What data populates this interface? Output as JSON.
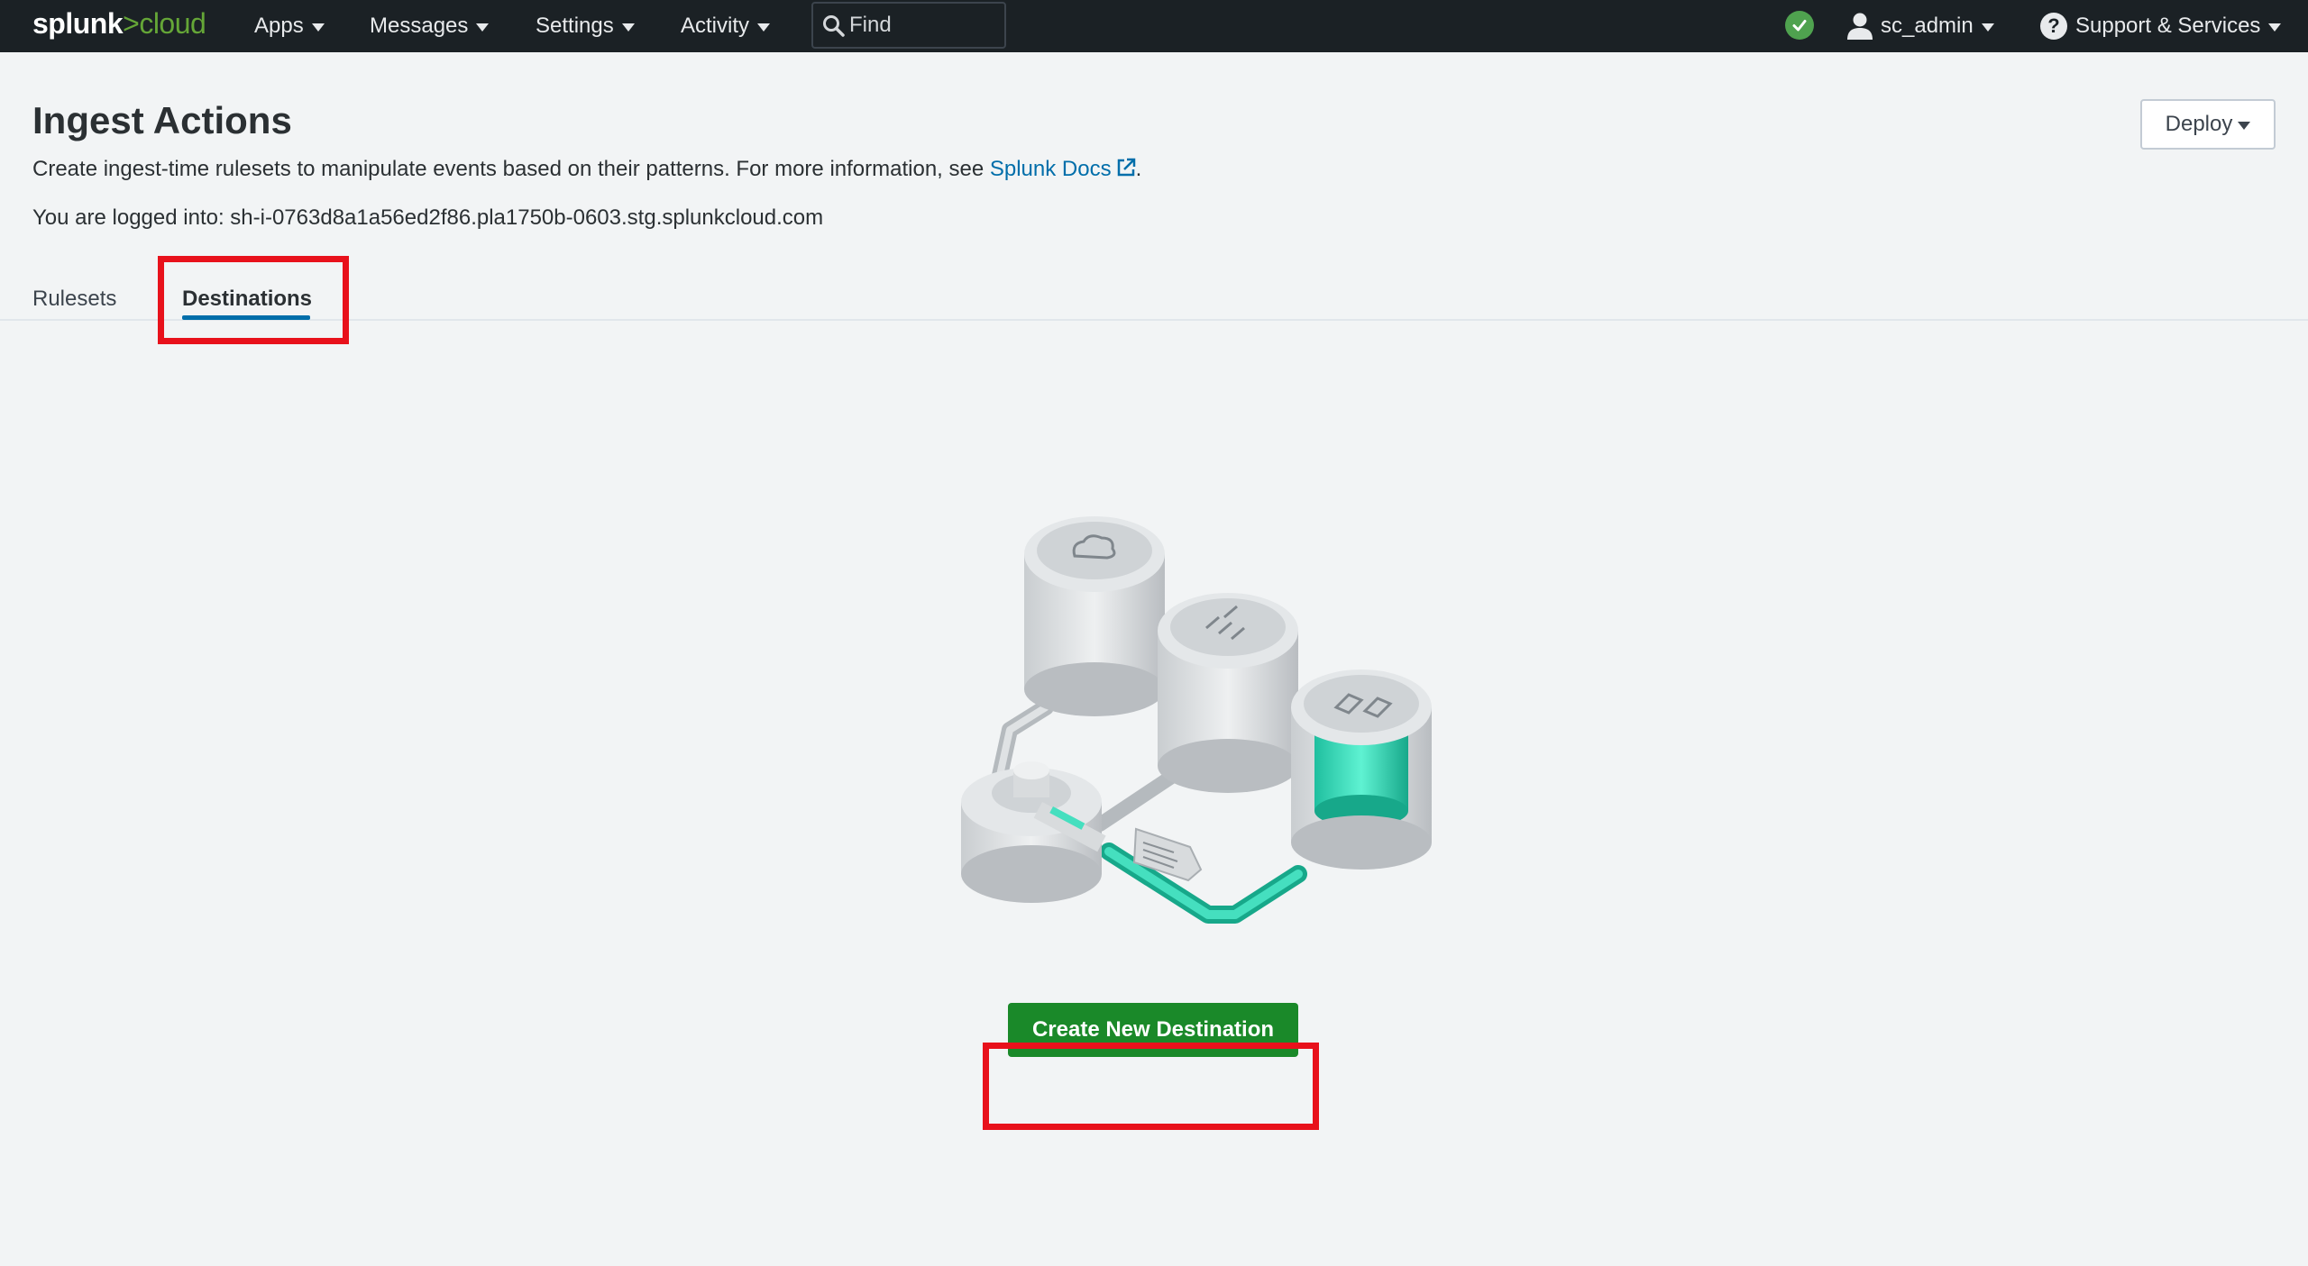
{
  "header": {
    "logo_primary": "splunk",
    "logo_separator": ">",
    "logo_secondary": "cloud",
    "nav": [
      {
        "label": "Apps"
      },
      {
        "label": "Messages"
      },
      {
        "label": "Settings"
      },
      {
        "label": "Activity"
      }
    ],
    "search_placeholder": "Find",
    "status_icon": "check-circle-icon",
    "status_color": "#4fa24f",
    "user_label": "sc_admin",
    "support_label": "Support & Services"
  },
  "page": {
    "title": "Ingest Actions",
    "description": "Create ingest-time rulesets to manipulate events based on their patterns. For more information, see ",
    "docs_link": "Splunk Docs",
    "description_end": ".",
    "logged_in": "You are logged into: sh-i-0763d8a1a56ed2f86.pla1750b-0603.stg.splunkcloud.com",
    "deploy_label": "Deploy"
  },
  "tabs": [
    {
      "label": "Rulesets",
      "active": false
    },
    {
      "label": "Destinations",
      "active": true
    }
  ],
  "empty_state": {
    "illustration": "data-pipeline-illustration",
    "create_button": "Create New Destination"
  },
  "colors": {
    "brand_green": "#65a637",
    "primary_button": "#1a8929",
    "link": "#006eaa",
    "highlight": "#e8111b",
    "accent_teal": "#2bcfae"
  }
}
